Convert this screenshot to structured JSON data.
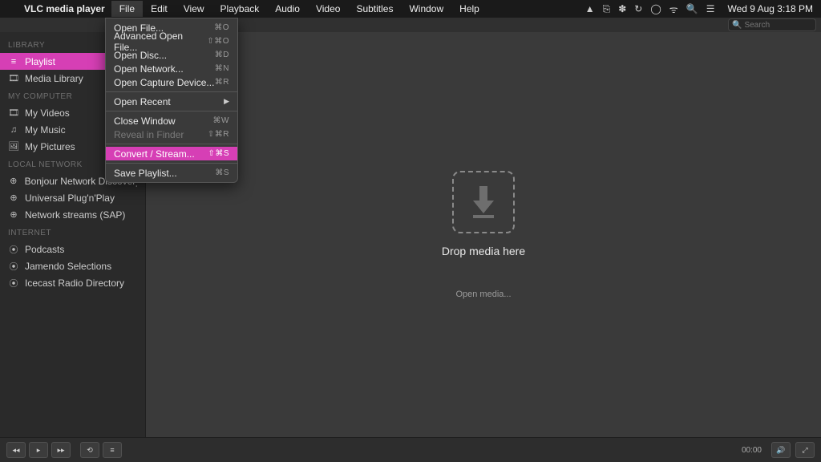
{
  "menubar": {
    "app": "VLC media player",
    "items": [
      "File",
      "Edit",
      "View",
      "Playback",
      "Audio",
      "Video",
      "Subtitles",
      "Window",
      "Help"
    ],
    "open_index": 0,
    "clock": "Wed 9 Aug  3:18 PM"
  },
  "search": {
    "placeholder": "Search"
  },
  "sidebar": {
    "sections": [
      {
        "title": "LIBRARY",
        "items": [
          {
            "icon": "list",
            "label": "Playlist",
            "active": true
          },
          {
            "icon": "film",
            "label": "Media Library"
          }
        ]
      },
      {
        "title": "MY COMPUTER",
        "items": [
          {
            "icon": "film",
            "label": "My Videos"
          },
          {
            "icon": "music",
            "label": "My Music"
          },
          {
            "icon": "image",
            "label": "My Pictures"
          }
        ]
      },
      {
        "title": "LOCAL NETWORK",
        "items": [
          {
            "icon": "globe",
            "label": "Bonjour Network Discovery"
          },
          {
            "icon": "globe",
            "label": "Universal Plug'n'Play"
          },
          {
            "icon": "globe",
            "label": "Network streams (SAP)"
          }
        ]
      },
      {
        "title": "INTERNET",
        "items": [
          {
            "icon": "podcast",
            "label": "Podcasts"
          },
          {
            "icon": "podcast",
            "label": "Jamendo Selections"
          },
          {
            "icon": "podcast",
            "label": "Icecast Radio Directory"
          }
        ]
      }
    ]
  },
  "content": {
    "drop_title": "Drop media here",
    "open_media": "Open media..."
  },
  "controls": {
    "time": "00:00"
  },
  "file_menu": {
    "groups": [
      [
        {
          "label": "Open File...",
          "shortcut": "⌘O"
        },
        {
          "label": "Advanced Open File...",
          "shortcut": "⇧⌘O"
        },
        {
          "label": "Open Disc...",
          "shortcut": "⌘D"
        },
        {
          "label": "Open Network...",
          "shortcut": "⌘N"
        },
        {
          "label": "Open Capture Device...",
          "shortcut": "⌘R"
        }
      ],
      [
        {
          "label": "Open Recent",
          "submenu": true
        }
      ],
      [
        {
          "label": "Close Window",
          "shortcut": "⌘W"
        },
        {
          "label": "Reveal in Finder",
          "shortcut": "⇧⌘R",
          "disabled": true
        }
      ],
      [
        {
          "label": "Convert / Stream...",
          "shortcut": "⇧⌘S",
          "highlight": true
        }
      ],
      [
        {
          "label": "Save Playlist...",
          "shortcut": "⌘S"
        }
      ]
    ]
  },
  "icon_map": {
    "list": "≡",
    "film": "🎞",
    "music": "♫",
    "image": "🖼",
    "globe": "⊕",
    "podcast": "⦿"
  }
}
